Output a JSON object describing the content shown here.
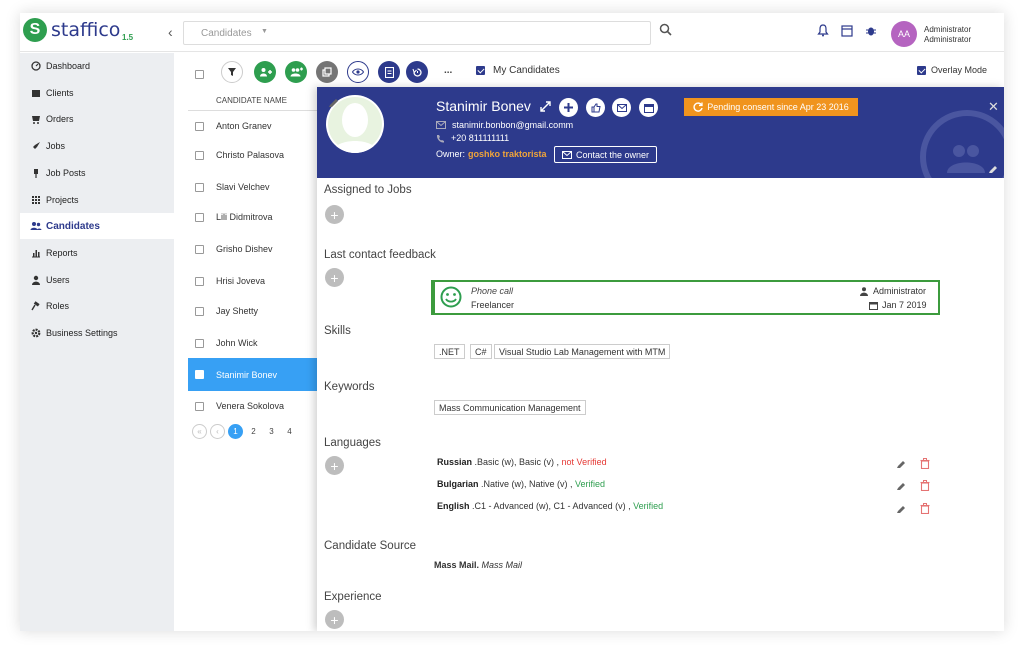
{
  "app": {
    "logo_letter": "S",
    "logo_text": "staffico",
    "version": "1.5"
  },
  "topbar": {
    "search_placeholder": "Candidates",
    "user_initials": "AA",
    "user_name": "Administrator",
    "user_role": "Administrator"
  },
  "sidebar": {
    "items": [
      {
        "label": "Dashboard",
        "icon": "dashboard-icon"
      },
      {
        "label": "Clients",
        "icon": "clients-icon"
      },
      {
        "label": "Orders",
        "icon": "orders-icon"
      },
      {
        "label": "Jobs",
        "icon": "rocket-icon"
      },
      {
        "label": "Job Posts",
        "icon": "pin-icon"
      },
      {
        "label": "Projects",
        "icon": "grid-icon"
      },
      {
        "label": "Candidates",
        "icon": "users-icon"
      },
      {
        "label": "Reports",
        "icon": "bar-chart-icon"
      },
      {
        "label": "Users",
        "icon": "user-icon"
      },
      {
        "label": "Roles",
        "icon": "gavel-icon"
      },
      {
        "label": "Business Settings",
        "icon": "gear-icon"
      }
    ],
    "active_index": 6
  },
  "toolbar": {
    "more_label": "...",
    "my_candidates_label": "My Candidates",
    "overlay_mode_label": "Overlay Mode"
  },
  "list": {
    "column_header": "CANDIDATE NAME",
    "rows": [
      "Anton Granev",
      "Christo Palasova",
      "Slavi Velchev",
      "Lili Didmitrova",
      "Grisho Dishev",
      "Hrisi Joveva",
      "Jay Shetty",
      "John Wick",
      "Stanimir Bonev",
      "Venera Sokolova"
    ],
    "selected_index": 8,
    "pages": [
      "1",
      "2",
      "3",
      "4"
    ],
    "current_page": "1"
  },
  "candidate": {
    "name": "Stanimir Bonev",
    "pending_consent": "Pending consent since Apr 23 2016",
    "email": "stanimir.bonbon@gmail.comm",
    "phone": "+20 811111111",
    "owner_label": "Owner:",
    "owner_name": "goshko traktorista",
    "contact_owner_label": "Contact the owner"
  },
  "sections": {
    "assigned_jobs": "Assigned to Jobs",
    "last_contact": "Last contact feedback",
    "skills": "Skills",
    "keywords": "Keywords",
    "languages": "Languages",
    "candidate_source": "Candidate Source",
    "experience": "Experience"
  },
  "feedback": {
    "type": "Phone call",
    "note": "Freelancer",
    "author": "Administrator",
    "date": "Jan 7 2019"
  },
  "skills": [
    ".NET",
    "C#",
    "Visual Studio Lab Management with MTM"
  ],
  "keywords": [
    "Mass Communication Management"
  ],
  "languages": [
    {
      "name": "Russian",
      "levels": " .Basic (w), Basic (v) ,",
      "status": "not Verified",
      "verified": false
    },
    {
      "name": "Bulgarian",
      "levels": " .Native (w), Native (v) ,",
      "status": "Verified",
      "verified": true
    },
    {
      "name": "English",
      "levels": " .C1 - Advanced (w), C1 - Advanced (v) ,",
      "status": "Verified",
      "verified": true
    }
  ],
  "source": {
    "name": "Mass Mail.",
    "detail": "Mass Mail"
  },
  "colors": {
    "brand_blue": "#2d3a8c",
    "brand_green": "#2e9e4f",
    "accent_orange": "#f0941e",
    "selected_blue": "#37a0f4"
  }
}
